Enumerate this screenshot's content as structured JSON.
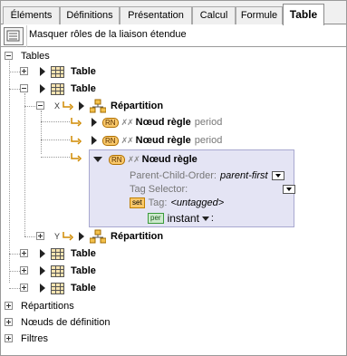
{
  "tabs": [
    "Éléments",
    "Définitions",
    "Présentation",
    "Calcul",
    "Formule",
    "Table"
  ],
  "active_tab": "Table",
  "toolbar": {
    "label": "Masquer rôles de la liaison étendue"
  },
  "tree": {
    "root": "Tables",
    "table_label": "Table",
    "breakdown_label": "Répartition",
    "rule_node_label": "Nœud règle",
    "rule_suffix": "period",
    "rn_badge": "RN",
    "axis_x": "X",
    "axis_y": "Y",
    "bottom_items": [
      "Répartitions",
      "Nœuds de définition",
      "Filtres"
    ]
  },
  "panel": {
    "title": "Nœud règle",
    "parent_child_label": "Parent-Child-Order:",
    "parent_child_value": "parent-first",
    "tag_selector_label": "Tag Selector:",
    "tag_label": "Tag:",
    "tag_value": "<untagged>",
    "set_badge": "set",
    "per_badge": "per",
    "instant_value": "instant",
    "instant_suffix": ":"
  },
  "colors": {
    "panel_bg": "#e4e4f4",
    "table_icon": "#f6e3b0",
    "rn_badge": "#f9c86a"
  }
}
